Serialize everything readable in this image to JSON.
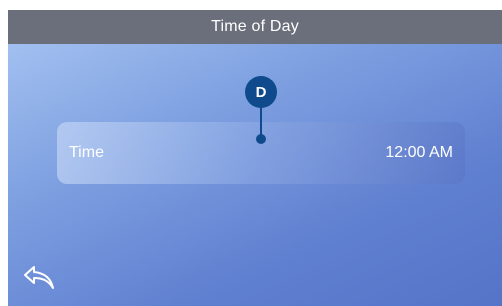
{
  "header": {
    "title": "Time of Day"
  },
  "marker": {
    "letter": "D"
  },
  "time_row": {
    "label": "Time",
    "value": "12:00 AM"
  },
  "icons": {
    "back": "back-arrow-icon"
  },
  "colors": {
    "title_bar": "#6b6f7b",
    "marker": "#0e4a8c",
    "background_light": "#a9c6f3",
    "background_dark": "#5574c8"
  }
}
